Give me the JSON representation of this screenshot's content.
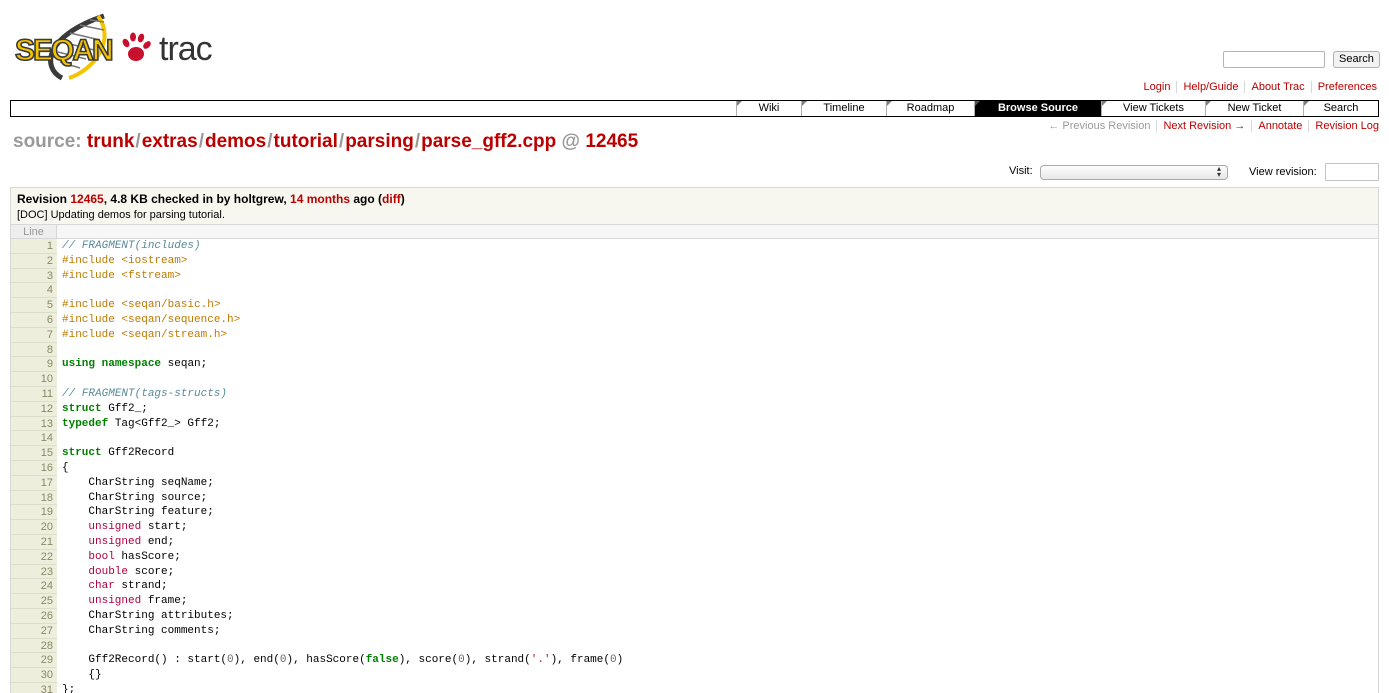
{
  "header": {
    "logo_text_left": "SEQAN",
    "logo_text_right": "trac",
    "search_button": "Search",
    "search_value": ""
  },
  "metanav": [
    "Login",
    "Help/Guide",
    "About Trac",
    "Preferences"
  ],
  "mainnav": [
    {
      "label": "Wiki",
      "width": 65,
      "active": false
    },
    {
      "label": "Timeline",
      "width": 85,
      "active": false
    },
    {
      "label": "Roadmap",
      "width": 88,
      "active": false
    },
    {
      "label": "Browse Source",
      "width": 127,
      "active": true
    },
    {
      "label": "View Tickets",
      "width": 104,
      "active": false
    },
    {
      "label": "New Ticket",
      "width": 98,
      "active": false
    },
    {
      "label": "Search",
      "width": 75,
      "active": false
    }
  ],
  "ctxtnav": [
    {
      "label": "← Previous Revision",
      "disabled": true
    },
    {
      "label": "Next Revision →",
      "disabled": false
    },
    {
      "label": "Annotate",
      "disabled": false
    },
    {
      "label": "Revision Log",
      "disabled": false
    }
  ],
  "path": {
    "prefix": "source:",
    "segments": [
      "trunk",
      "extras",
      "demos",
      "tutorial",
      "parsing",
      "parse_gff2.cpp"
    ],
    "at": "@",
    "revision": "12465"
  },
  "visit": {
    "label": "Visit:",
    "selected": ""
  },
  "view_revision": {
    "label": "View revision:",
    "value": ""
  },
  "info": {
    "revision_word": "Revision",
    "revision": "12465",
    "size_text": ", 4.8 KB checked in by holtgrew,",
    "age": "14 months",
    "age_suffix": "ago (",
    "diff": "diff",
    "close_paren": ")",
    "message": "[DOC] Updating demos for parsing tutorial."
  },
  "code": {
    "column_header": "Line",
    "lines": [
      [
        [
          "c",
          "// FRAGMENT(includes)"
        ]
      ],
      [
        [
          "p",
          "#include <iostream>"
        ]
      ],
      [
        [
          "p",
          "#include <fstream>"
        ]
      ],
      [],
      [
        [
          "p",
          "#include <seqan/basic.h>"
        ]
      ],
      [
        [
          "p",
          "#include <seqan/sequence.h>"
        ]
      ],
      [
        [
          "p",
          "#include <seqan/stream.h>"
        ]
      ],
      [],
      [
        [
          "k",
          "using"
        ],
        [
          "n",
          " "
        ],
        [
          "k",
          "namespace"
        ],
        [
          "n",
          " seqan;"
        ]
      ],
      [],
      [
        [
          "c",
          "// FRAGMENT(tags-structs)"
        ]
      ],
      [
        [
          "k",
          "struct"
        ],
        [
          "n",
          " Gff2_;"
        ]
      ],
      [
        [
          "k",
          "typedef"
        ],
        [
          "n",
          " Tag<Gff2_> Gff2;"
        ]
      ],
      [],
      [
        [
          "k",
          "struct"
        ],
        [
          "n",
          " Gff2Record"
        ]
      ],
      [
        [
          "n",
          "{"
        ]
      ],
      [
        [
          "n",
          "    CharString seqName;"
        ]
      ],
      [
        [
          "n",
          "    CharString source;"
        ]
      ],
      [
        [
          "n",
          "    CharString feature;"
        ]
      ],
      [
        [
          "n",
          "    "
        ],
        [
          "t",
          "unsigned"
        ],
        [
          "n",
          " start;"
        ]
      ],
      [
        [
          "n",
          "    "
        ],
        [
          "t",
          "unsigned"
        ],
        [
          "n",
          " end;"
        ]
      ],
      [
        [
          "n",
          "    "
        ],
        [
          "t",
          "bool"
        ],
        [
          "n",
          " hasScore;"
        ]
      ],
      [
        [
          "n",
          "    "
        ],
        [
          "t",
          "double"
        ],
        [
          "n",
          " score;"
        ]
      ],
      [
        [
          "n",
          "    "
        ],
        [
          "t",
          "char"
        ],
        [
          "n",
          " strand;"
        ]
      ],
      [
        [
          "n",
          "    "
        ],
        [
          "t",
          "unsigned"
        ],
        [
          "n",
          " frame;"
        ]
      ],
      [
        [
          "n",
          "    CharString attributes;"
        ]
      ],
      [
        [
          "n",
          "    CharString comments;"
        ]
      ],
      [],
      [
        [
          "n",
          "    Gff2Record() : start("
        ],
        [
          "d",
          "0"
        ],
        [
          "n",
          "), end("
        ],
        [
          "d",
          "0"
        ],
        [
          "n",
          "), hasScore("
        ],
        [
          "k",
          "false"
        ],
        [
          "n",
          "), score("
        ],
        [
          "d",
          "0"
        ],
        [
          "n",
          "), strand("
        ],
        [
          "s",
          "'.'"
        ],
        [
          "n",
          "), frame("
        ],
        [
          "d",
          "0"
        ],
        [
          "n",
          ")"
        ]
      ],
      [
        [
          "n",
          "    {}"
        ]
      ],
      [
        [
          "n",
          "};"
        ]
      ]
    ]
  }
}
